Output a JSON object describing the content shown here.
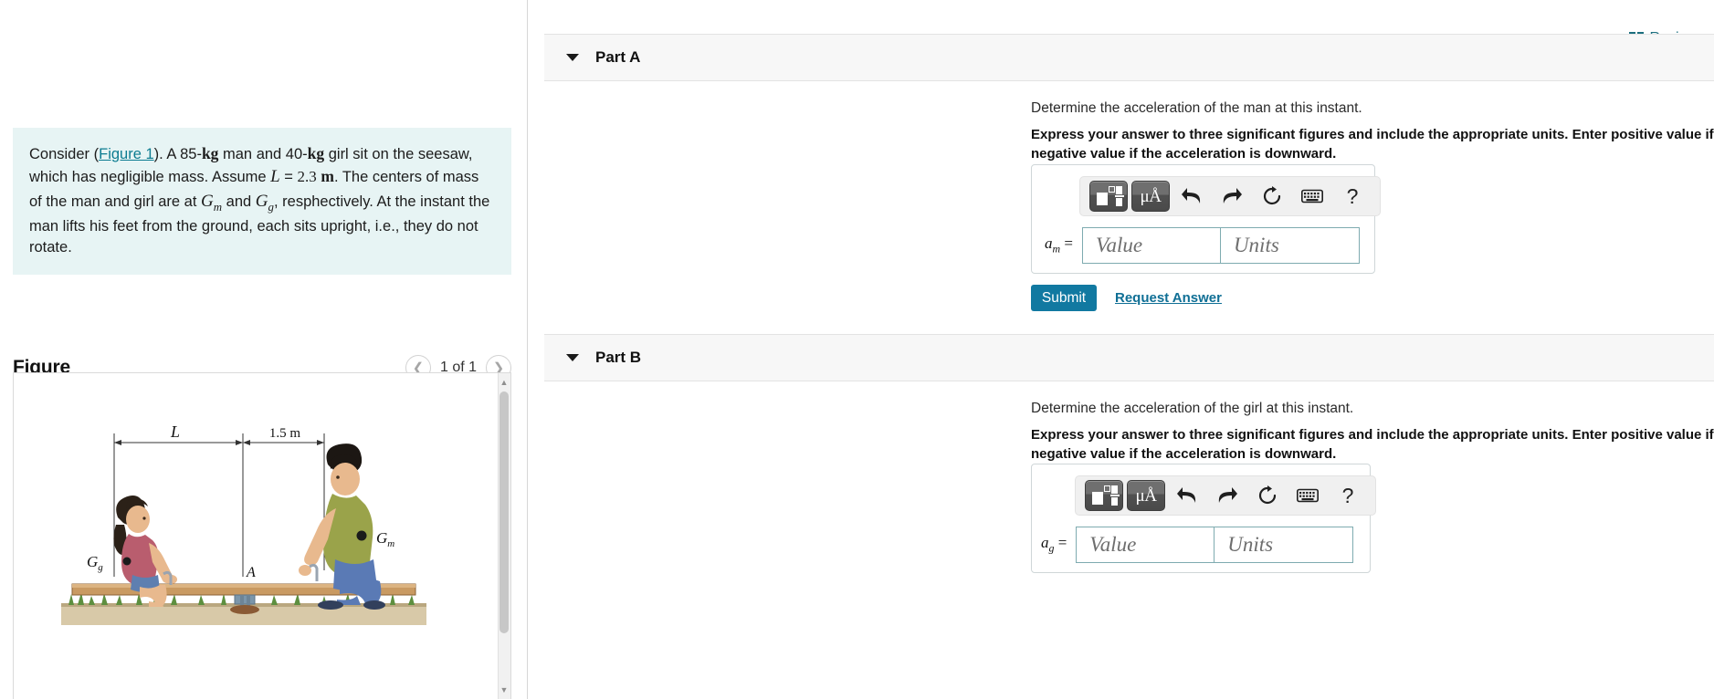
{
  "left": {
    "problem": {
      "lead": "Consider (",
      "figure_link": "Figure 1",
      "after_link": "). A 85-",
      "unit_kg_1": "kg",
      "mid1": " man and 40-",
      "unit_kg_2": "kg",
      "mid2": " girl sit on the seesaw, which has negligible mass. Assume ",
      "var_L": "L",
      "eq": " = ",
      "val_L": "2.3",
      "unit_m": "m",
      "mid3": ". The centers of mass of the man and girl are at ",
      "var_Gm": "G",
      "sub_m": "m",
      "mid4": " and ",
      "var_Gg": "G",
      "sub_g": "g",
      "tail": ", resphectively. At the instant the man lifts his feet from the ground, each sits upright, i.e., they do not rotate."
    },
    "figure": {
      "title": "Figure",
      "prev_icon": "chevron-left-icon",
      "next_icon": "chevron-right-icon",
      "counter": "1 of 1",
      "labels": {
        "dim_L": "L",
        "dim_right": "1.5 m",
        "pivot": "A",
        "cg_girl": "G",
        "cg_girl_sub": "g",
        "cg_man": "G",
        "cg_man_sub": "m"
      }
    }
  },
  "right": {
    "review": {
      "icon": "book-icon",
      "label": "Review"
    },
    "parts": [
      {
        "caret_icon": "caret-down-icon",
        "title": "Part A",
        "question": "Determine the acceleration of the man at this instant.",
        "instruction": "Express your answer to three significant figures and include the appropriate units. Enter positive value if the acceleration is upward and negative value if the acceleration is downward.",
        "toolbar": {
          "template_icon": "math-template-icon",
          "units_icon": "micro-angstrom-units-icon",
          "units_label": "μÅ",
          "undo_icon": "undo-arrow-icon",
          "redo_icon": "redo-arrow-icon",
          "reset_icon": "reset-circle-icon",
          "keyboard_icon": "keyboard-icon",
          "help_icon": "help-question-icon",
          "help_label": "?"
        },
        "answer": {
          "label_var": "a",
          "label_sub": "m",
          "label_eq": " =",
          "value_placeholder": "Value",
          "units_placeholder": "Units",
          "value": "",
          "units": ""
        },
        "submit_label": "Submit",
        "request_label": "Request Answer"
      },
      {
        "caret_icon": "caret-down-icon",
        "title": "Part B",
        "question": "Determine the acceleration of the girl at this instant.",
        "instruction": "Express your answer to three significant figures and include the appropriate units. Enter positive value if the acceleration is upward and negative value if the acceleration is downward.",
        "toolbar": {
          "template_icon": "math-template-icon",
          "units_icon": "micro-angstrom-units-icon",
          "units_label": "μÅ",
          "undo_icon": "undo-arrow-icon",
          "redo_icon": "redo-arrow-icon",
          "reset_icon": "reset-circle-icon",
          "keyboard_icon": "keyboard-icon",
          "help_icon": "help-question-icon",
          "help_label": "?"
        },
        "answer": {
          "label_var": "a",
          "label_sub": "g",
          "label_eq": " =",
          "value_placeholder": "Value",
          "units_placeholder": "Units",
          "value": "",
          "units": ""
        }
      }
    ]
  },
  "colors": {
    "accent": "#1179a1",
    "link": "#0f6f95",
    "problem_bg": "#e7f4f4",
    "header_bg": "#f7f7f7",
    "input_border": "#7eabb0"
  }
}
